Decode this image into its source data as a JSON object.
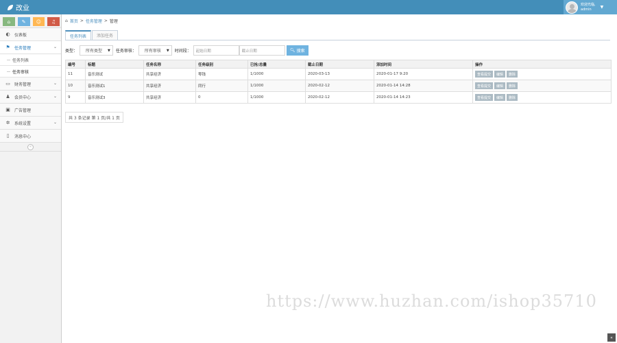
{
  "app": {
    "brand": "改业"
  },
  "user": {
    "line1": "欢迎光临,",
    "name": "admin"
  },
  "sidebar": {
    "shortcuts": [
      {
        "icon": "home-icon",
        "glyph": "⌂"
      },
      {
        "icon": "pencil-icon",
        "glyph": "✎"
      },
      {
        "icon": "users-icon",
        "glyph": "☺"
      },
      {
        "icon": "bell-icon",
        "glyph": "♫"
      }
    ],
    "items": [
      {
        "label": "仪表板",
        "icon": "dashboard-icon",
        "glyph": "◐"
      },
      {
        "label": "任务管理",
        "icon": "flag-icon",
        "glyph": "⚑"
      },
      {
        "label": "任务列表"
      },
      {
        "label": "任务审核"
      },
      {
        "label": "财务管理",
        "icon": "printer-icon",
        "glyph": "▭"
      },
      {
        "label": "会员中心",
        "icon": "user-icon",
        "glyph": "♟"
      },
      {
        "label": "广告管理",
        "icon": "picture-icon",
        "glyph": "▣"
      },
      {
        "label": "系统设置",
        "icon": "cog-icon",
        "glyph": "✲"
      },
      {
        "label": "消息中心",
        "icon": "bookmark-icon",
        "glyph": "▯"
      }
    ]
  },
  "breadcrumb": {
    "home": "首页",
    "section": "任务管理",
    "current": "管理"
  },
  "tabs": [
    "任务列表",
    "添加任务"
  ],
  "filters": {
    "type_label": "类型：",
    "type_value": "所有类型",
    "status_label": "任务审核：",
    "status_value": "所有审核",
    "time_label": "时间段：",
    "start_placeholder": "起始日期",
    "end_placeholder": "截止日期",
    "search_label": "搜索"
  },
  "table": {
    "headers": [
      "编号",
      "标题",
      "任务名称",
      "任务级别",
      "已抢/总量",
      "截止日期",
      "添加时间",
      "操作"
    ],
    "rows": [
      {
        "cells": [
          "11",
          "音乐测试",
          "共享经济",
          "零钱",
          "1/1000",
          "2020-03-13",
          "2020-01-17 9:20"
        ],
        "ops": [
          "查看提交",
          "编辑",
          "删除"
        ]
      },
      {
        "cells": [
          "10",
          "音乐测试1",
          "共享经济",
          "同行",
          "1/1000",
          "2020-02-12",
          "2020-01-14 14:28"
        ],
        "ops": [
          "查看提交",
          "编辑",
          "删除"
        ]
      },
      {
        "cells": [
          "9",
          "音乐测试3",
          "共享经济",
          "0",
          "1/1000",
          "2020-02-12",
          "2020-01-14 14:23"
        ],
        "ops": [
          "查看提交",
          "编辑",
          "删除"
        ]
      }
    ]
  },
  "pager": {
    "text": "共 3 条记录 第 1 页/共 1 页"
  },
  "watermark": "https://www.huzhan.com/ishop35710",
  "colors": {
    "topbar": "#438eb9",
    "accent": "#4c8fbd",
    "search_button": "#6fb3e0"
  }
}
